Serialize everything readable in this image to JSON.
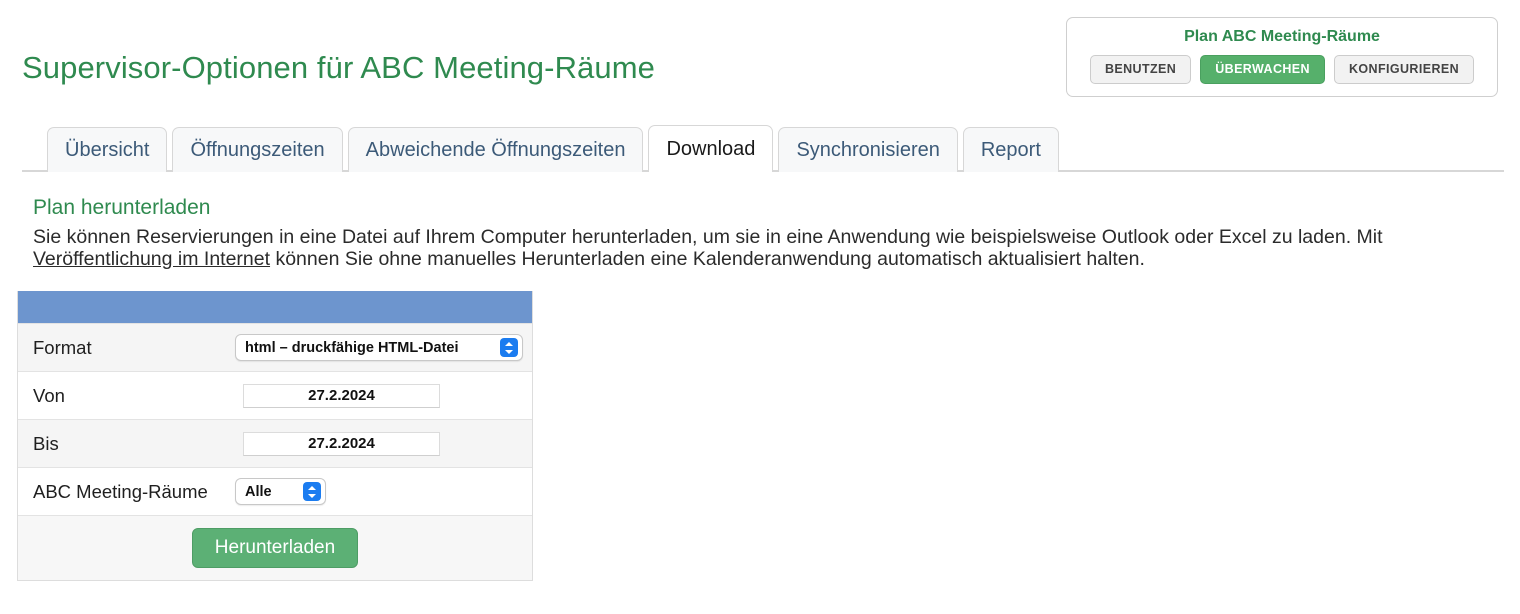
{
  "header": {
    "page_title": "Supervisor-Optionen für ABC Meeting-Räume"
  },
  "plan_box": {
    "title": "Plan ABC Meeting-Räume",
    "buttons": [
      {
        "label": "BENUTZEN",
        "active": false
      },
      {
        "label": "ÜBERWACHEN",
        "active": true
      },
      {
        "label": "KONFIGURIEREN",
        "active": false
      }
    ]
  },
  "tabs": [
    {
      "label": "Übersicht",
      "active": false
    },
    {
      "label": "Öffnungszeiten",
      "active": false
    },
    {
      "label": "Abweichende Öffnungszeiten",
      "active": false
    },
    {
      "label": "Download",
      "active": true
    },
    {
      "label": "Synchronisieren",
      "active": false
    },
    {
      "label": "Report",
      "active": false
    }
  ],
  "content": {
    "section_title": "Plan herunterladen",
    "paragraph_part1": "Sie können Reservierungen in eine Datei auf Ihrem Computer herunterladen, um sie in eine Anwendung wie beispielsweise Outlook oder Excel zu laden. Mit ",
    "paragraph_link": "Veröffentlichung im Internet",
    "paragraph_part2": " können Sie ohne manuelles Herunterladen eine Kalenderanwendung automatisch aktualisiert halten."
  },
  "form": {
    "rows": [
      {
        "label": "Format",
        "value": "html – druckfähige HTML-Datei"
      },
      {
        "label": "Von",
        "value": "27.2.2024"
      },
      {
        "label": "Bis",
        "value": "27.2.2024"
      },
      {
        "label": "ABC Meeting-Räume",
        "value": "Alle"
      }
    ],
    "submit_label": "Herunterladen"
  },
  "colors": {
    "brand_green": "#2f8a4f",
    "button_green": "#5cb075",
    "active_toggle_green": "#56b06b",
    "table_header_blue": "#6d95ce",
    "stepper_blue": "#1b7cf0",
    "tab_text_blue": "#3c5a78"
  }
}
